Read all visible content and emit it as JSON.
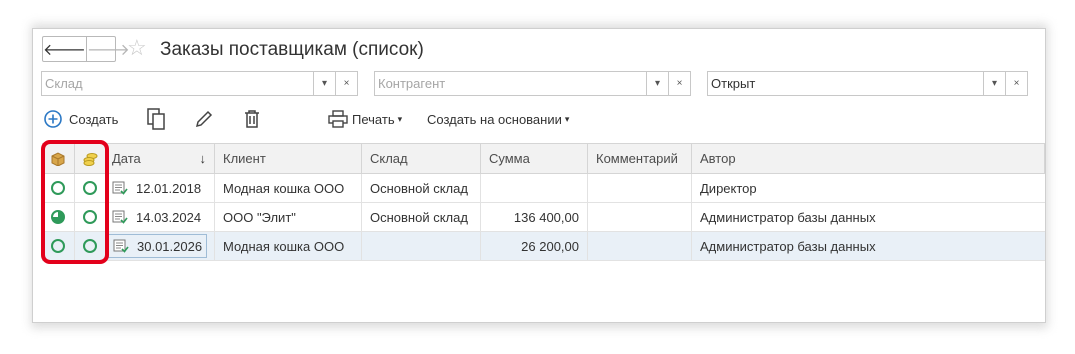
{
  "window": {
    "title": "Заказы поставщикам (список)",
    "nav_back": "🡐",
    "nav_forward": "🡒",
    "star": "☆"
  },
  "filters": {
    "warehouse": {
      "placeholder": "Склад",
      "value": ""
    },
    "counterparty": {
      "placeholder": "Контрагент",
      "value": ""
    },
    "status": {
      "value": "Открыт"
    },
    "dropdown_glyph": "▾",
    "clear_glyph": "×"
  },
  "toolbar": {
    "create_label": "Создать",
    "print_label": "Печать",
    "create_based_label": "Создать на основании",
    "caret": "▾"
  },
  "table": {
    "columns": [
      "Дата",
      "Клиент",
      "Склад",
      "Сумма",
      "Комментарий",
      "Автор"
    ],
    "sort_indicator": "↓",
    "rows": [
      {
        "status1": "open",
        "status2": "open",
        "date": "12.01.2018",
        "client": "Модная кошка ООО",
        "warehouse": "Основной склад",
        "sum": "",
        "comment": "",
        "author": "Директор"
      },
      {
        "status1": "partial",
        "status2": "open",
        "date": "14.03.2024",
        "client": "ООО \"Элит\"",
        "warehouse": "Основной склад",
        "sum": "136 400,00",
        "comment": "",
        "author": "Администратор базы данных"
      },
      {
        "status1": "open",
        "status2": "open",
        "date": "30.01.2026",
        "client": "Модная кошка ООО",
        "warehouse": "",
        "sum": "26 200,00",
        "comment": "",
        "author": "Администратор базы данных"
      }
    ]
  },
  "colors": {
    "accent": "#2f9a5a",
    "highlight": "#e3001b",
    "selected_row": "#e9f0f7"
  }
}
